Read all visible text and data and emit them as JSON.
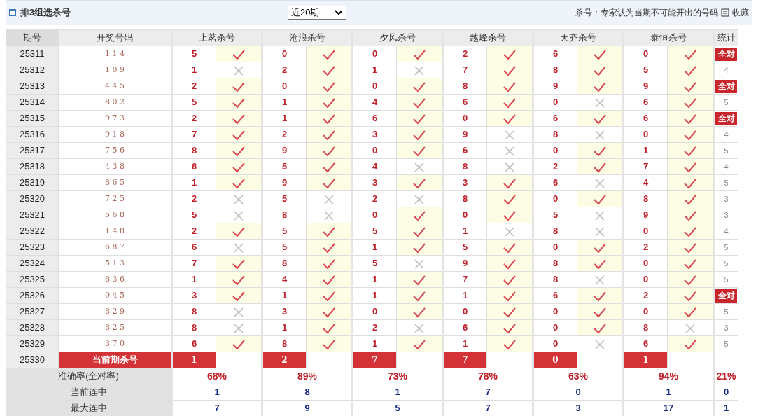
{
  "header": {
    "title": "排3组选杀号",
    "period_select": "近20期",
    "note": "杀号：专家认为当期不可能开出的号码",
    "favorite": "收藏"
  },
  "table": {
    "columns": {
      "issue": "期号",
      "draw": "开奖号码",
      "experts": [
        "上茗杀号",
        "沧浪杀号",
        "夕风杀号",
        "越峰杀号",
        "天齐杀号",
        "泰恒杀号"
      ],
      "stats": "统计"
    },
    "rows": [
      {
        "issue": "25311",
        "draw": "1 1 4",
        "kills": [
          {
            "num": "5",
            "hit": true
          },
          {
            "num": "0",
            "hit": true
          },
          {
            "num": "0",
            "hit": true
          },
          {
            "num": "2",
            "hit": true
          },
          {
            "num": "6",
            "hit": true
          },
          {
            "num": "0",
            "hit": true
          }
        ],
        "stat": {
          "text": "全对",
          "all_correct": true
        }
      },
      {
        "issue": "25312",
        "draw": "1 0 9",
        "kills": [
          {
            "num": "1",
            "hit": false
          },
          {
            "num": "2",
            "hit": true
          },
          {
            "num": "1",
            "hit": false
          },
          {
            "num": "7",
            "hit": true
          },
          {
            "num": "8",
            "hit": true
          },
          {
            "num": "5",
            "hit": true
          }
        ],
        "stat": {
          "text": "4",
          "all_correct": false
        }
      },
      {
        "issue": "25313",
        "draw": "4 4 5",
        "kills": [
          {
            "num": "2",
            "hit": true
          },
          {
            "num": "0",
            "hit": true
          },
          {
            "num": "0",
            "hit": true
          },
          {
            "num": "8",
            "hit": true
          },
          {
            "num": "9",
            "hit": true
          },
          {
            "num": "9",
            "hit": true
          }
        ],
        "stat": {
          "text": "全对",
          "all_correct": true
        }
      },
      {
        "issue": "25314",
        "draw": "8 0 2",
        "kills": [
          {
            "num": "5",
            "hit": true
          },
          {
            "num": "1",
            "hit": true
          },
          {
            "num": "4",
            "hit": true
          },
          {
            "num": "6",
            "hit": true
          },
          {
            "num": "0",
            "hit": false
          },
          {
            "num": "6",
            "hit": true
          }
        ],
        "stat": {
          "text": "5",
          "all_correct": false
        }
      },
      {
        "issue": "25315",
        "draw": "9 7 3",
        "kills": [
          {
            "num": "2",
            "hit": true
          },
          {
            "num": "1",
            "hit": true
          },
          {
            "num": "6",
            "hit": true
          },
          {
            "num": "0",
            "hit": true
          },
          {
            "num": "6",
            "hit": true
          },
          {
            "num": "6",
            "hit": true
          }
        ],
        "stat": {
          "text": "全对",
          "all_correct": true
        }
      },
      {
        "issue": "25316",
        "draw": "9 1 8",
        "kills": [
          {
            "num": "7",
            "hit": true
          },
          {
            "num": "2",
            "hit": true
          },
          {
            "num": "3",
            "hit": true
          },
          {
            "num": "9",
            "hit": false
          },
          {
            "num": "8",
            "hit": false
          },
          {
            "num": "0",
            "hit": true
          }
        ],
        "stat": {
          "text": "4",
          "all_correct": false
        }
      },
      {
        "issue": "25317",
        "draw": "7 5 6",
        "kills": [
          {
            "num": "8",
            "hit": true
          },
          {
            "num": "9",
            "hit": true
          },
          {
            "num": "0",
            "hit": true
          },
          {
            "num": "6",
            "hit": false
          },
          {
            "num": "0",
            "hit": true
          },
          {
            "num": "1",
            "hit": true
          }
        ],
        "stat": {
          "text": "5",
          "all_correct": false
        }
      },
      {
        "issue": "25318",
        "draw": "4 3 8",
        "kills": [
          {
            "num": "6",
            "hit": true
          },
          {
            "num": "5",
            "hit": true
          },
          {
            "num": "4",
            "hit": false
          },
          {
            "num": "8",
            "hit": false
          },
          {
            "num": "2",
            "hit": true
          },
          {
            "num": "7",
            "hit": true
          }
        ],
        "stat": {
          "text": "4",
          "all_correct": false
        }
      },
      {
        "issue": "25319",
        "draw": "8 6 5",
        "kills": [
          {
            "num": "1",
            "hit": true
          },
          {
            "num": "9",
            "hit": true
          },
          {
            "num": "3",
            "hit": true
          },
          {
            "num": "3",
            "hit": true
          },
          {
            "num": "6",
            "hit": false
          },
          {
            "num": "4",
            "hit": true
          }
        ],
        "stat": {
          "text": "5",
          "all_correct": false
        }
      },
      {
        "issue": "25320",
        "draw": "7 2 5",
        "kills": [
          {
            "num": "2",
            "hit": false
          },
          {
            "num": "5",
            "hit": false
          },
          {
            "num": "2",
            "hit": false
          },
          {
            "num": "8",
            "hit": true
          },
          {
            "num": "0",
            "hit": true
          },
          {
            "num": "8",
            "hit": true
          }
        ],
        "stat": {
          "text": "3",
          "all_correct": false
        }
      },
      {
        "issue": "25321",
        "draw": "5 6 8",
        "kills": [
          {
            "num": "5",
            "hit": false
          },
          {
            "num": "8",
            "hit": false
          },
          {
            "num": "0",
            "hit": true
          },
          {
            "num": "0",
            "hit": true
          },
          {
            "num": "5",
            "hit": false
          },
          {
            "num": "9",
            "hit": true
          }
        ],
        "stat": {
          "text": "3",
          "all_correct": false
        }
      },
      {
        "issue": "25322",
        "draw": "1 4 8",
        "kills": [
          {
            "num": "2",
            "hit": true
          },
          {
            "num": "5",
            "hit": true
          },
          {
            "num": "5",
            "hit": true
          },
          {
            "num": "1",
            "hit": false
          },
          {
            "num": "8",
            "hit": false
          },
          {
            "num": "0",
            "hit": true
          }
        ],
        "stat": {
          "text": "4",
          "all_correct": false
        }
      },
      {
        "issue": "25323",
        "draw": "6 8 7",
        "kills": [
          {
            "num": "6",
            "hit": false
          },
          {
            "num": "5",
            "hit": true
          },
          {
            "num": "1",
            "hit": true
          },
          {
            "num": "5",
            "hit": true
          },
          {
            "num": "0",
            "hit": true
          },
          {
            "num": "2",
            "hit": true
          }
        ],
        "stat": {
          "text": "5",
          "all_correct": false
        }
      },
      {
        "issue": "25324",
        "draw": "5 1 3",
        "kills": [
          {
            "num": "7",
            "hit": true
          },
          {
            "num": "8",
            "hit": true
          },
          {
            "num": "5",
            "hit": false
          },
          {
            "num": "9",
            "hit": true
          },
          {
            "num": "8",
            "hit": true
          },
          {
            "num": "0",
            "hit": true
          }
        ],
        "stat": {
          "text": "5",
          "all_correct": false
        }
      },
      {
        "issue": "25325",
        "draw": "8 3 6",
        "kills": [
          {
            "num": "1",
            "hit": true
          },
          {
            "num": "4",
            "hit": true
          },
          {
            "num": "1",
            "hit": true
          },
          {
            "num": "7",
            "hit": true
          },
          {
            "num": "8",
            "hit": false
          },
          {
            "num": "0",
            "hit": true
          }
        ],
        "stat": {
          "text": "5",
          "all_correct": false
        }
      },
      {
        "issue": "25326",
        "draw": "0 4 5",
        "kills": [
          {
            "num": "3",
            "hit": true
          },
          {
            "num": "1",
            "hit": true
          },
          {
            "num": "1",
            "hit": true
          },
          {
            "num": "1",
            "hit": true
          },
          {
            "num": "6",
            "hit": true
          },
          {
            "num": "2",
            "hit": true
          }
        ],
        "stat": {
          "text": "全对",
          "all_correct": true
        }
      },
      {
        "issue": "25327",
        "draw": "8 2 9",
        "kills": [
          {
            "num": "8",
            "hit": false
          },
          {
            "num": "3",
            "hit": true
          },
          {
            "num": "0",
            "hit": true
          },
          {
            "num": "0",
            "hit": true
          },
          {
            "num": "0",
            "hit": true
          },
          {
            "num": "0",
            "hit": true
          }
        ],
        "stat": {
          "text": "5",
          "all_correct": false
        }
      },
      {
        "issue": "25328",
        "draw": "8 2 5",
        "kills": [
          {
            "num": "8",
            "hit": false
          },
          {
            "num": "1",
            "hit": true
          },
          {
            "num": "2",
            "hit": false
          },
          {
            "num": "6",
            "hit": true
          },
          {
            "num": "0",
            "hit": true
          },
          {
            "num": "8",
            "hit": false
          }
        ],
        "stat": {
          "text": "3",
          "all_correct": false
        }
      },
      {
        "issue": "25329",
        "draw": "3 7 0",
        "kills": [
          {
            "num": "6",
            "hit": true
          },
          {
            "num": "8",
            "hit": true
          },
          {
            "num": "1",
            "hit": true
          },
          {
            "num": "1",
            "hit": true
          },
          {
            "num": "0",
            "hit": false
          },
          {
            "num": "6",
            "hit": true
          }
        ],
        "stat": {
          "text": "5",
          "all_correct": false
        }
      }
    ],
    "current": {
      "issue": "25330",
      "label": "当前期杀号",
      "kills": [
        "1",
        "2",
        "7",
        "7",
        "0",
        "1"
      ]
    },
    "summary": [
      {
        "label": "准确率(全对率)",
        "kind": "rate",
        "values": [
          "68%",
          "89%",
          "73%",
          "78%",
          "63%",
          "94%"
        ],
        "stat": "21%"
      },
      {
        "label": "当前连中",
        "kind": "streak",
        "values": [
          "1",
          "8",
          "1",
          "7",
          "0",
          "1"
        ],
        "stat": "0"
      },
      {
        "label": "最大连中",
        "kind": "streak",
        "values": [
          "7",
          "9",
          "5",
          "7",
          "3",
          "17"
        ],
        "stat": "1"
      }
    ]
  }
}
